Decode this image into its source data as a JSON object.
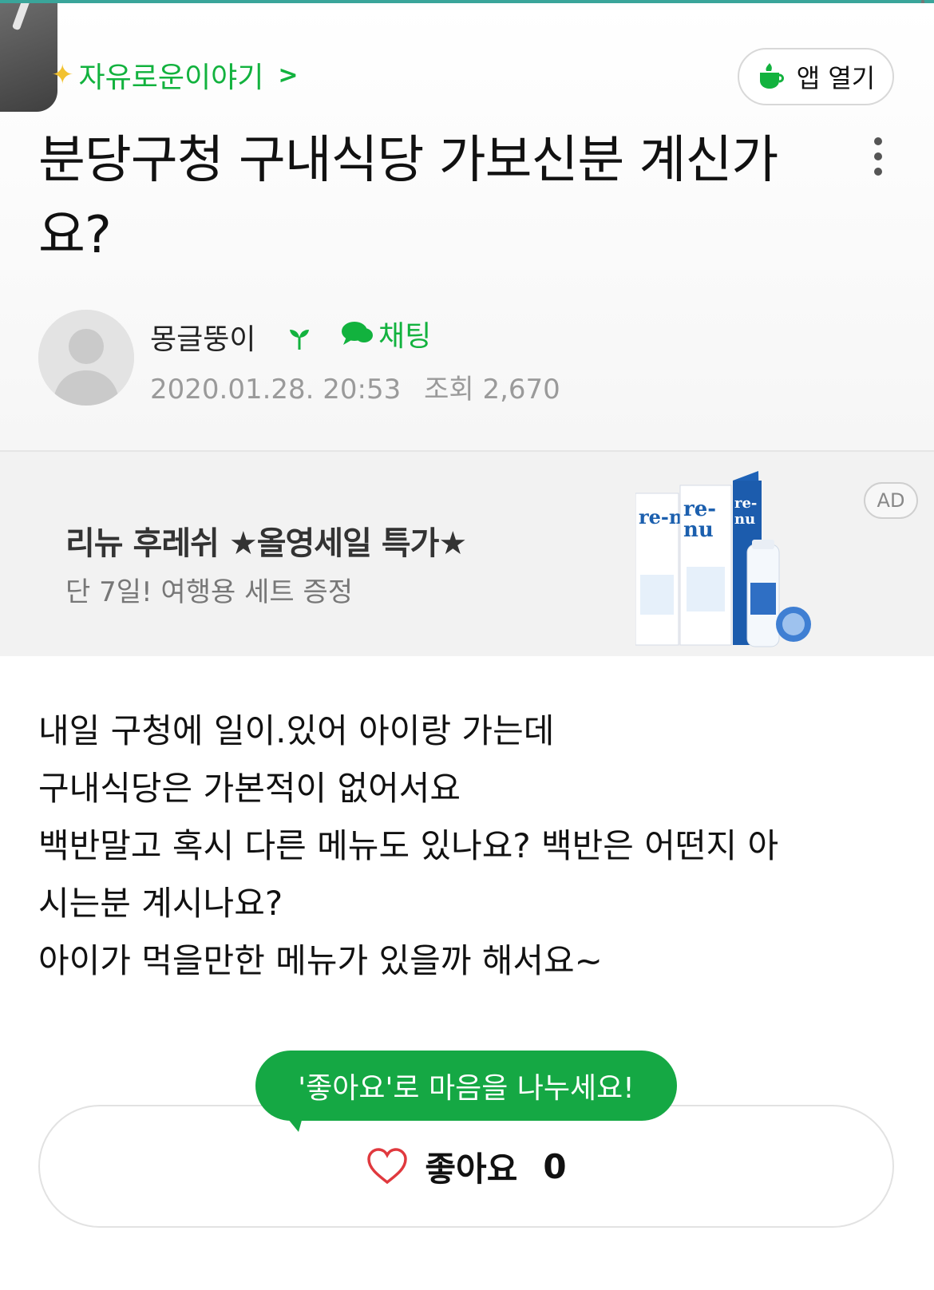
{
  "board": {
    "name": "자유로운이야기",
    "chevron": ">"
  },
  "app_open": {
    "label": "앱 열기"
  },
  "post": {
    "title": "분당구청 구내식당 가보신분 계신가요?",
    "author": "몽글뚱이",
    "chat_label": "채팅",
    "date": "2020.01.28. 20:53",
    "views": "조회 2,670",
    "body": [
      "내일 구청에 일이.있어 아이랑 가는데",
      "구내식당은 가본적이 없어서요",
      "백반말고 혹시 다른 메뉴도 있나요? 백반은 어떤지 아",
      "시는분 계시나요?",
      "아이가 먹을만한 메뉴가 있을까 해서요~"
    ]
  },
  "ad": {
    "title": "리뉴 후레쉬 ★올영세일 특가★",
    "subtitle": "단 7일! 여행용 세트 증정",
    "badge": "AD",
    "product_brand": "re-nu"
  },
  "like": {
    "tooltip": "'좋아요'로 마음을 나누세요!",
    "label": "좋아요",
    "count": "0"
  },
  "colors": {
    "accent_green": "#12b23e",
    "tooltip_green": "#15a844",
    "meta_gray": "#9a9a9a",
    "ad_bg": "#f2f2f2",
    "heart_red": "#e0393e"
  }
}
